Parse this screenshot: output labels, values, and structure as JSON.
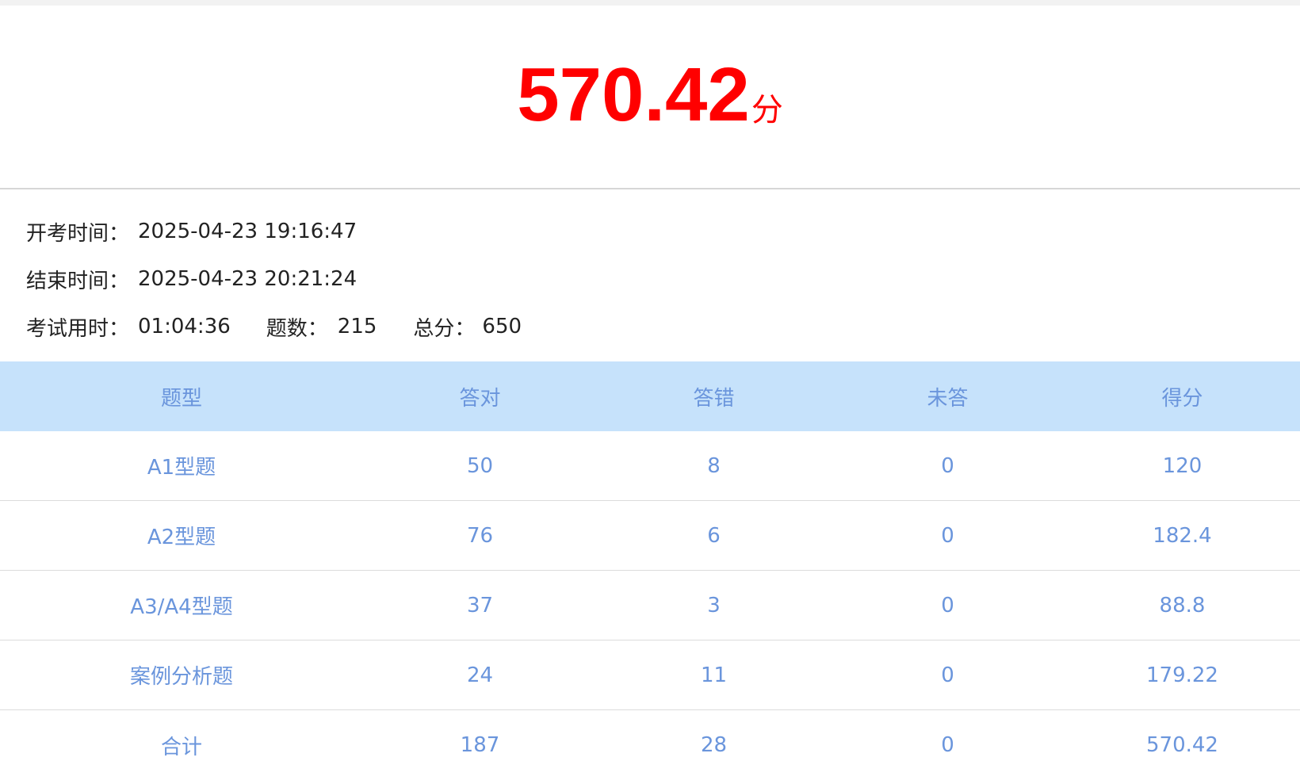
{
  "score": {
    "value": "570.42",
    "unit": "分"
  },
  "info": {
    "start_label": "开考时间：",
    "start_value": "2025-04-23 19:16:47",
    "end_label": "结束时间：",
    "end_value": "2025-04-23 20:21:24",
    "duration_label": "考试用时：",
    "duration_value": "01:04:36",
    "count_label": "题数：",
    "count_value": "215",
    "total_label": "总分：",
    "total_value": "650"
  },
  "table": {
    "headers": [
      "题型",
      "答对",
      "答错",
      "未答",
      "得分"
    ],
    "rows": [
      [
        "A1型题",
        "50",
        "8",
        "0",
        "120"
      ],
      [
        "A2型题",
        "76",
        "6",
        "0",
        "182.4"
      ],
      [
        "A3/A4型题",
        "37",
        "3",
        "0",
        "88.8"
      ],
      [
        "案例分析题",
        "24",
        "11",
        "0",
        "179.22"
      ],
      [
        "合计",
        "187",
        "28",
        "0",
        "570.42"
      ]
    ]
  },
  "colors": {
    "score": "#ff0000",
    "header_bg": "#c6e2fb",
    "table_text": "#6a95dc"
  }
}
